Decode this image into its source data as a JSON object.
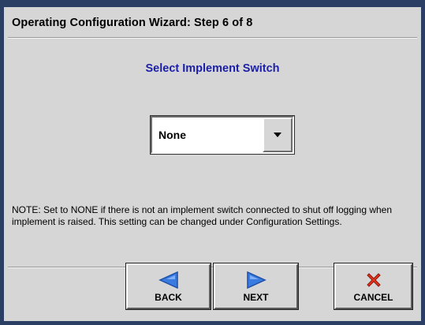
{
  "window": {
    "title": "Operating Configuration Wizard:  Step 6 of 8"
  },
  "main": {
    "heading": "Select Implement Switch",
    "dropdown": {
      "selected": "None"
    },
    "note": "NOTE:  Set to NONE if there is not an implement switch connected to shut off logging when implement is raised.  This setting can be changed under Configuration Settings."
  },
  "buttons": {
    "back_label": "BACK",
    "next_label": "NEXT",
    "cancel_label": "CANCEL"
  },
  "icons": {
    "back": "left-triangle-icon",
    "next": "right-triangle-icon",
    "cancel": "red-x-icon"
  },
  "colors": {
    "heading": "#1b1fa8",
    "dialog_bg": "#d6d6d6",
    "arrow_blue": "#3a7be0",
    "cancel_red": "#e8331c"
  }
}
